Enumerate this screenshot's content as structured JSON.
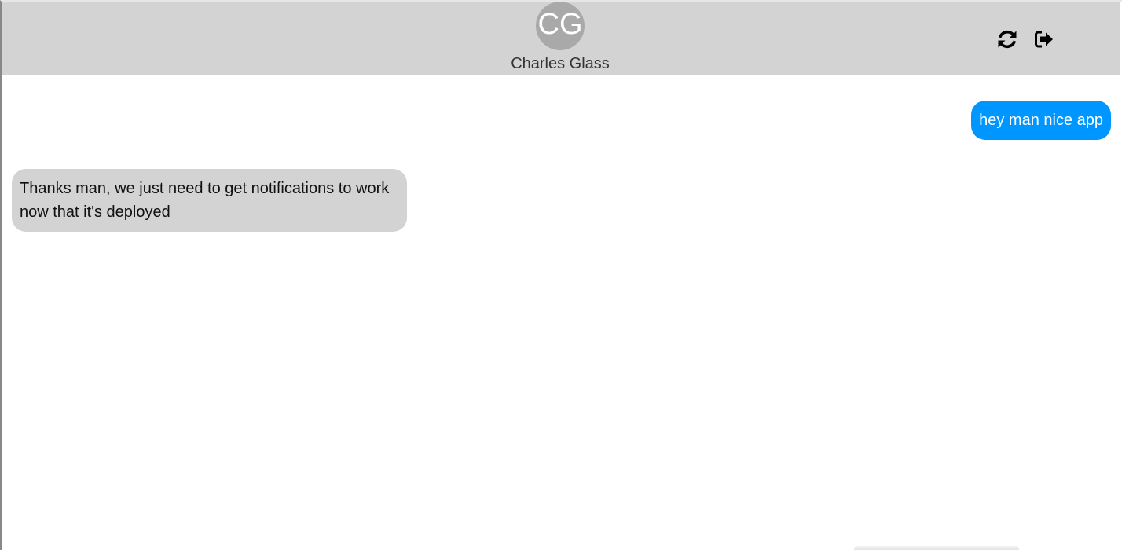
{
  "header": {
    "avatar_initials": "CG",
    "contact_name": "Charles Glass",
    "refresh_icon": "refresh-icon",
    "logout_icon": "logout-icon"
  },
  "messages": [
    {
      "direction": "sent",
      "text": "hey man nice app"
    },
    {
      "direction": "received",
      "text": "Thanks man, we just need to get notifications to work now that it's deployed"
    }
  ],
  "colors": {
    "header_bg": "#d3d3d3",
    "avatar_bg": "#a9a9a9",
    "sent_bubble": "#0096ff",
    "received_bubble": "#d3d3d3"
  }
}
